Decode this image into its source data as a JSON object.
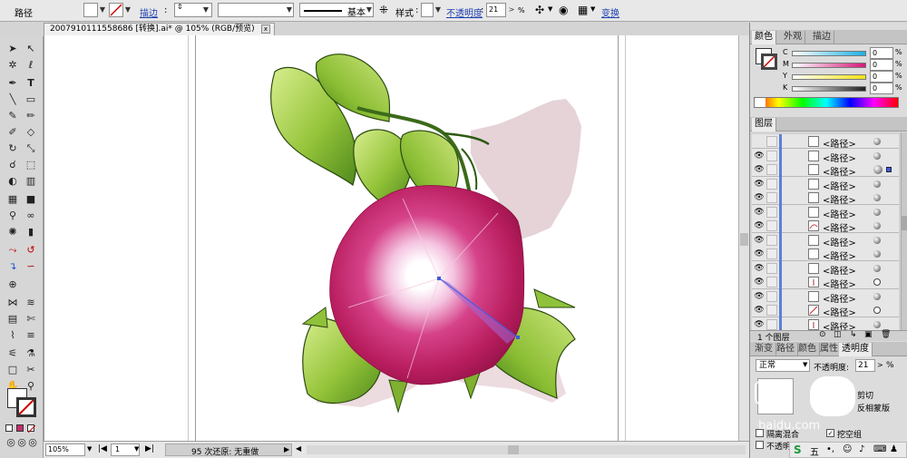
{
  "control_bar": {
    "object_label": "路径",
    "stroke_label": "描边",
    "stroke_style": "基本",
    "style_label": "样式",
    "opacity_label": "不透明度",
    "opacity_value": "21",
    "opacity_unit": "%",
    "transform_label": "变换"
  },
  "document": {
    "tab_title": "200791011155868​6 [转换].ai* @ 105% (RGB/预览)",
    "close": "x"
  },
  "status_bar": {
    "zoom": "105%",
    "page": "1",
    "status_text": "95 次还原: 无重做"
  },
  "color_panel": {
    "tabs": [
      "颜色",
      "外观",
      "描边"
    ],
    "channels": [
      {
        "name": "C",
        "value": "0",
        "color": "#19b1e8"
      },
      {
        "name": "M",
        "value": "0",
        "color": "#d41a7a"
      },
      {
        "name": "Y",
        "value": "0",
        "color": "#f2e313"
      },
      {
        "name": "K",
        "value": "0",
        "color": "#222222"
      }
    ],
    "unit": "%"
  },
  "layers_panel": {
    "title": "图层",
    "item_label": "<路径>",
    "items": [
      {
        "name": "<路径>",
        "target": "filled",
        "thumb": "blank"
      },
      {
        "name": "<路径>",
        "target": "filled",
        "thumb": "blank"
      },
      {
        "name": "<路径>",
        "target": "selected",
        "thumb": "blank"
      },
      {
        "name": "<路径>",
        "target": "filled",
        "thumb": "blank"
      },
      {
        "name": "<路径>",
        "target": "filled",
        "thumb": "blank"
      },
      {
        "name": "<路径>",
        "target": "filled",
        "thumb": "blank"
      },
      {
        "name": "<路径>",
        "target": "filled",
        "thumb": "curve"
      },
      {
        "name": "<路径>",
        "target": "filled",
        "thumb": "blank"
      },
      {
        "name": "<路径>",
        "target": "filled",
        "thumb": "blank"
      },
      {
        "name": "<路径>",
        "target": "filled",
        "thumb": "blank"
      },
      {
        "name": "<路径>",
        "target": "open",
        "thumb": "mark"
      },
      {
        "name": "<路径>",
        "target": "filled",
        "thumb": "blank"
      },
      {
        "name": "<路径>",
        "target": "open",
        "thumb": "line"
      },
      {
        "name": "<路径>",
        "target": "filled",
        "thumb": "mark"
      }
    ],
    "footer": "1 个图层"
  },
  "transparency_panel": {
    "tabs": [
      "渐变",
      "路径",
      "颜色",
      "属性",
      "透明度"
    ],
    "blend_mode": "正常",
    "opacity_label": "不透明度:",
    "opacity_value": "21",
    "unit": "%",
    "clip_label": "剪切",
    "invert_label": "反相蒙版",
    "isolate_label": "隔离混合",
    "knockout_label": "挖空组",
    "opacity_mask_label": "不透明"
  },
  "watermark": {
    "text": "baidu.com"
  }
}
